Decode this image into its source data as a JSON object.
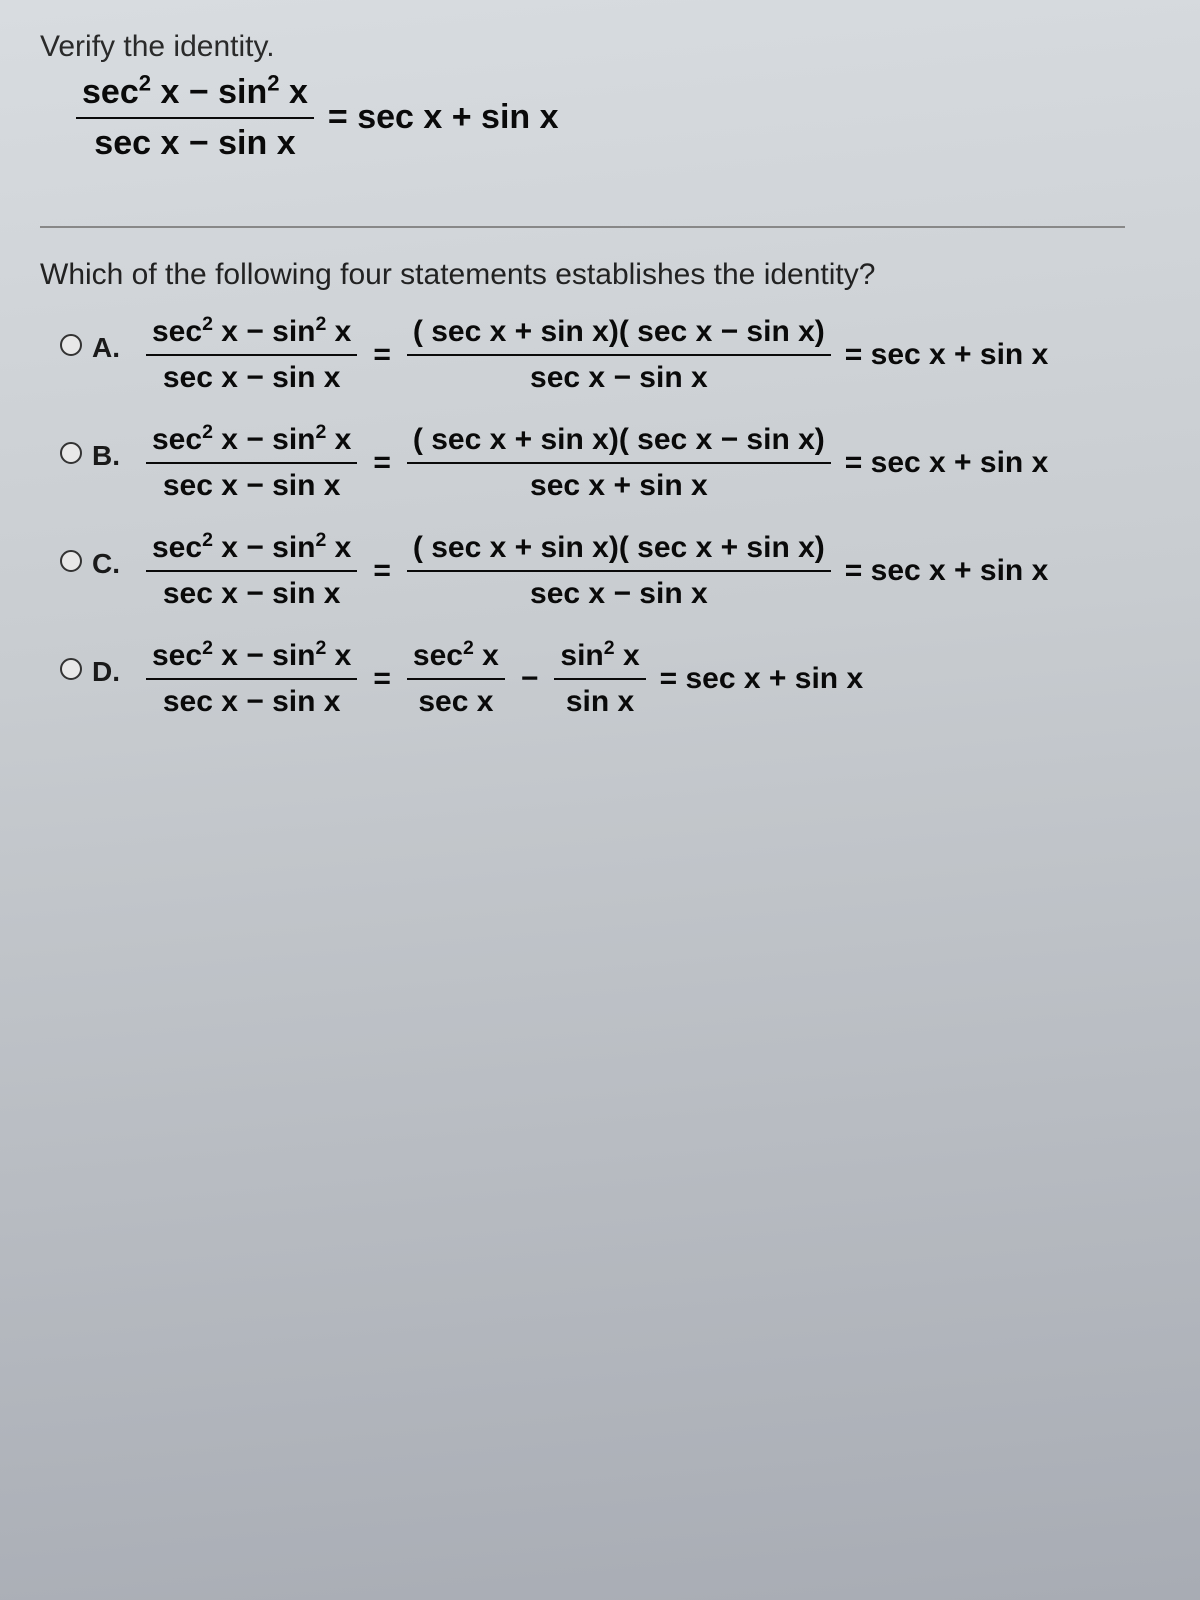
{
  "title": "Verify the identity.",
  "identity": {
    "lhs_num": "sec² x − sin² x",
    "lhs_den": "sec x − sin x",
    "rhs": "= sec x + sin x"
  },
  "question": "Which of the following four statements establishes the identity?",
  "options": [
    {
      "label": "A.",
      "lhs_num": "sec² x − sin² x",
      "lhs_den": "sec x − sin x",
      "mid_num": "( sec x + sin x)( sec x − sin x)",
      "mid_den": "sec x − sin x",
      "result": "= sec x + sin x"
    },
    {
      "label": "B.",
      "lhs_num": "sec² x − sin² x",
      "lhs_den": "sec x − sin x",
      "mid_num": "( sec x + sin x)( sec x − sin x)",
      "mid_den": "sec x + sin x",
      "result": "= sec x + sin x"
    },
    {
      "label": "C.",
      "lhs_num": "sec² x − sin² x",
      "lhs_den": "sec x − sin x",
      "mid_num": "( sec x + sin x)( sec x + sin x)",
      "mid_den": "sec x − sin x",
      "result": "= sec x + sin x"
    },
    {
      "label": "D.",
      "lhs_num": "sec² x − sin² x",
      "lhs_den": "sec x − sin x",
      "d_f1_num": "sec² x",
      "d_f1_den": "sec x",
      "d_minus": "−",
      "d_f2_num": "sin² x",
      "d_f2_den": "sin x",
      "result": "= sec x + sin x"
    }
  ]
}
